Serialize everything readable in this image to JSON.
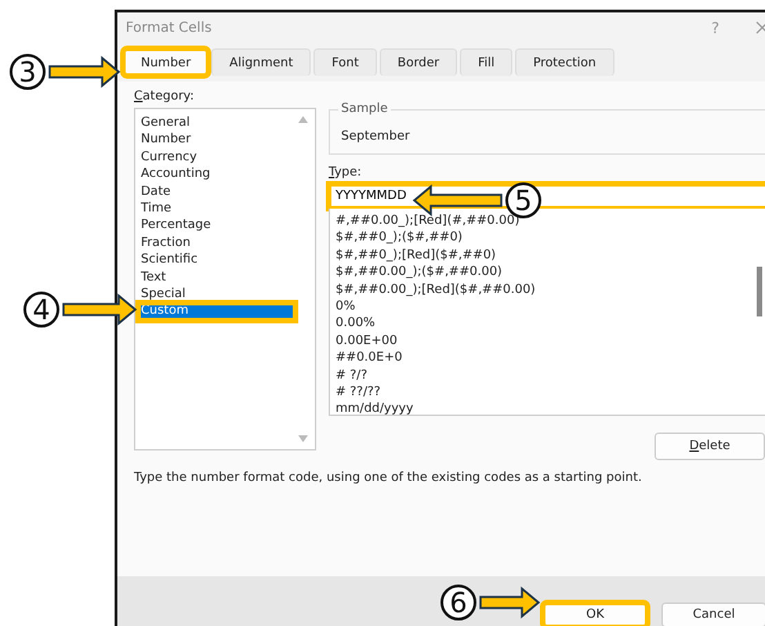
{
  "window": {
    "title": "Format Cells",
    "help": "?"
  },
  "tabs": [
    {
      "label": "Number",
      "selected": true,
      "highlighted": true
    },
    {
      "label": "Alignment",
      "selected": false,
      "highlighted": false
    },
    {
      "label": "Font",
      "selected": false,
      "highlighted": false
    },
    {
      "label": "Border",
      "selected": false,
      "highlighted": false
    },
    {
      "label": "Fill",
      "selected": false,
      "highlighted": false
    },
    {
      "label": "Protection",
      "selected": false,
      "highlighted": false
    }
  ],
  "category": {
    "label": "Category:",
    "items": [
      {
        "label": "General",
        "selected": false,
        "highlighted": false
      },
      {
        "label": "Number",
        "selected": false,
        "highlighted": false
      },
      {
        "label": "Currency",
        "selected": false,
        "highlighted": false
      },
      {
        "label": "Accounting",
        "selected": false,
        "highlighted": false
      },
      {
        "label": "Date",
        "selected": false,
        "highlighted": false
      },
      {
        "label": "Time",
        "selected": false,
        "highlighted": false
      },
      {
        "label": "Percentage",
        "selected": false,
        "highlighted": false
      },
      {
        "label": "Fraction",
        "selected": false,
        "highlighted": false
      },
      {
        "label": "Scientific",
        "selected": false,
        "highlighted": false
      },
      {
        "label": "Text",
        "selected": false,
        "highlighted": false
      },
      {
        "label": "Special",
        "selected": false,
        "highlighted": false
      },
      {
        "label": "Custom",
        "selected": true,
        "highlighted": true
      }
    ]
  },
  "sample": {
    "label": "Sample",
    "value": "September"
  },
  "type": {
    "label": "Type:",
    "value": "YYYYMMDD",
    "highlighted": true,
    "formats": [
      "#,##0.00_);[Red](#,##0.00)",
      "$#,##0_);($#,##0)",
      "$#,##0_);[Red]($#,##0)",
      "$#,##0.00_);($#,##0.00)",
      "$#,##0.00_);[Red]($#,##0.00)",
      "0%",
      "0.00%",
      "0.00E+00",
      "##0.0E+0",
      "# ?/?",
      "# ??/??",
      "mm/dd/yyyy"
    ]
  },
  "delete_button": "Delete",
  "hint": "Type the number format code, using one of the existing codes as a starting point.",
  "buttons": [
    {
      "label": "OK",
      "highlighted": true
    },
    {
      "label": "Cancel",
      "highlighted": false
    }
  ],
  "callouts": [
    {
      "number": "3"
    },
    {
      "number": "4"
    },
    {
      "number": "5"
    },
    {
      "number": "6"
    }
  ]
}
